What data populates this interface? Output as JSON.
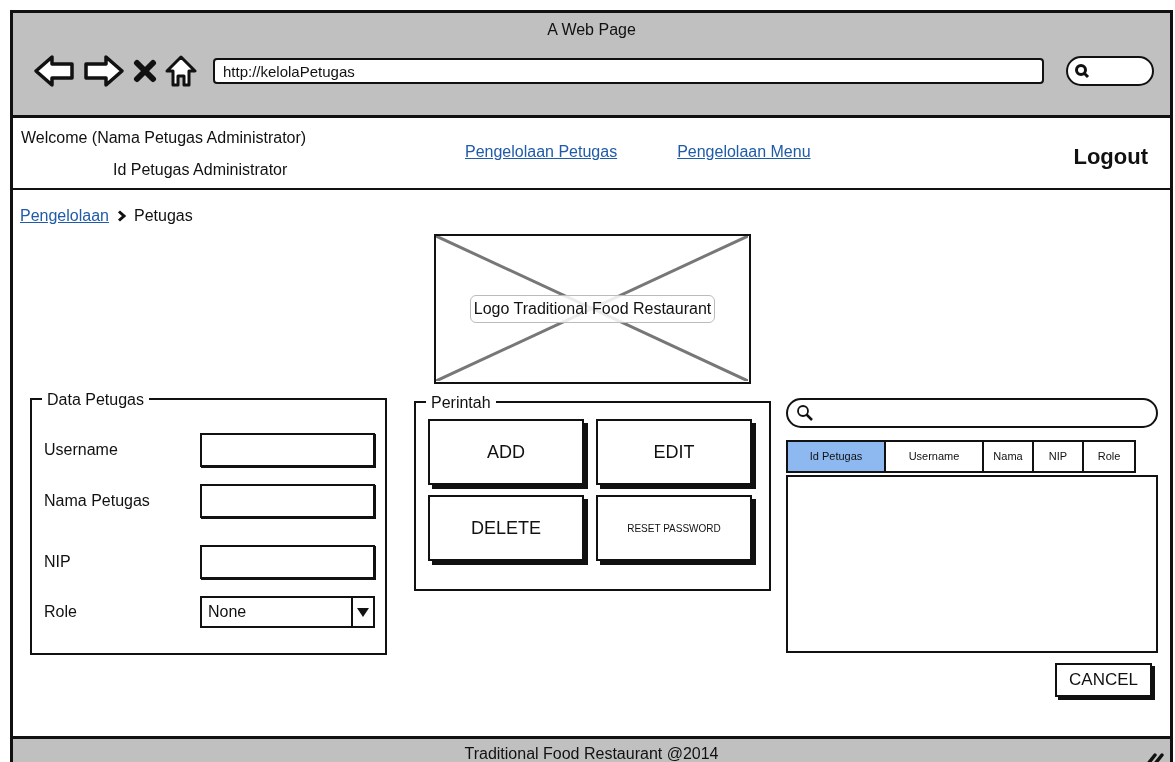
{
  "window": {
    "title": "A Web Page",
    "address": "http://kelolaPetugas"
  },
  "header": {
    "welcome": "Welcome (Nama Petugas Administrator)",
    "user_id": "Id Petugas Administrator",
    "nav_links": [
      "Pengelolaan Petugas",
      "Pengelolaan Menu"
    ],
    "logout": "Logout"
  },
  "breadcrumb": [
    {
      "label": "Pengelolaan",
      "kind": "link"
    },
    {
      "label": "Petugas",
      "kind": "current"
    }
  ],
  "logo": {
    "label": "Logo Traditional Food Restaurant"
  },
  "data_petugas": {
    "title": "Data Petugas",
    "fields": [
      {
        "label": "Username",
        "kind": "text"
      },
      {
        "label": "Nama Petugas",
        "kind": "text"
      },
      {
        "label": "NIP",
        "kind": "text"
      },
      {
        "label": "Role",
        "kind": "select",
        "value": "None"
      }
    ]
  },
  "perintah": {
    "title": "Perintah",
    "buttons": [
      {
        "label": "ADD",
        "kind": "large"
      },
      {
        "label": "EDIT",
        "kind": "large"
      },
      {
        "label": "DELETE",
        "kind": "large"
      },
      {
        "label": "RESET PASSWORD",
        "kind": "small"
      }
    ]
  },
  "table": {
    "columns": [
      {
        "label": "Id Petugas",
        "selected": true
      },
      {
        "label": "Username",
        "selected": false
      },
      {
        "label": "Nama",
        "selected": false
      },
      {
        "label": "NIP",
        "selected": false
      },
      {
        "label": "Role",
        "selected": false
      }
    ]
  },
  "cancel": "CANCEL",
  "footer": "Traditional Food Restaurant @2014"
}
